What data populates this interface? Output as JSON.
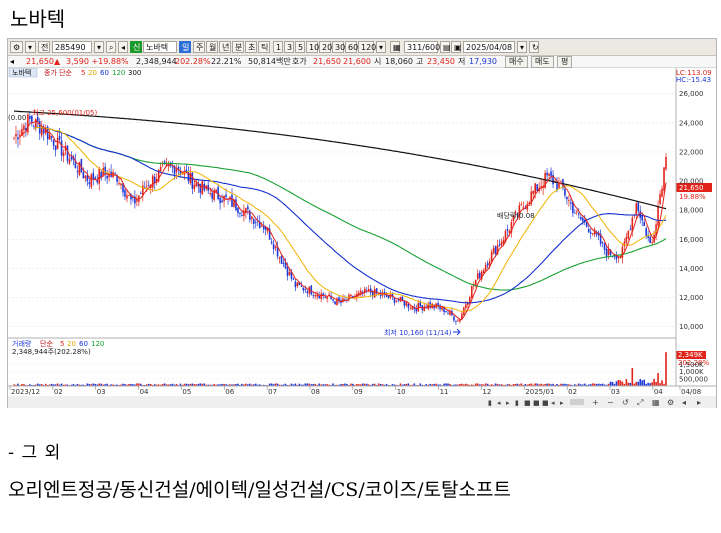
{
  "heading": "노바텍",
  "toolbar": {
    "code": "285490",
    "type_flag": "신",
    "name": "노바텍",
    "period_selected": "일",
    "periods": [
      "주",
      "월",
      "년",
      "분",
      "초",
      "틱"
    ],
    "intervals": [
      "1",
      "3",
      "5",
      "10",
      "20",
      "30",
      "60",
      "120"
    ],
    "count": "311/600",
    "date": "2025/04/08"
  },
  "infobar": {
    "price": "21,650▲",
    "change": "3,590 +19.88%",
    "volume": "2,348,944",
    "volume_ratio": "202.28%",
    "turnover": "22.21%",
    "amount": "50,814백만",
    "quote_label": "호가",
    "ask": "21,650",
    "bid": "21,600",
    "open_label": "시",
    "open": "18,060",
    "high_label": "고",
    "high": "23,450",
    "low_label": "저",
    "low": "17,930",
    "buy_btn": "매수",
    "sell_btn": "매도",
    "extra_btn": "평"
  },
  "chart": {
    "price_legend": {
      "name": "노바텍",
      "label": "종가 단순",
      "ma": [
        "5",
        "20",
        "60",
        "120",
        "300"
      ]
    },
    "volume_legend": {
      "label": "거래량",
      "ma_label": "단순",
      "ma": [
        "5",
        "20",
        "60",
        "120"
      ],
      "value": "2,348,944주(202.28%)"
    },
    "lc_hc": [
      "LC:113.09",
      "HC:-15.43"
    ],
    "current_price_label": "21,650",
    "current_price_pct": "19.88%",
    "volume_badge": [
      "2,349K",
      "202.28%"
    ],
    "annotations": {
      "high": "최고 25,600(01/05)",
      "low": "최저 10,160 (11/14)",
      "left_value": "(0.00",
      "mid": "배당락(0.08"
    },
    "y_ticks": [
      "26,000",
      "24,000",
      "22,000",
      "20,000",
      "18,000",
      "16,000",
      "14,000",
      "12,000",
      "10,000"
    ],
    "vol_ticks": [
      "1,500K",
      "1,000K",
      "500,000"
    ],
    "x_ticks": [
      "2023/12",
      "02",
      "03",
      "04",
      "05",
      "06",
      "07",
      "08",
      "09",
      "10",
      "11",
      "12",
      "2025/01",
      "02",
      "03",
      "04",
      "04/08"
    ]
  },
  "colors": {
    "up": "#e2231a",
    "down": "#1e39d8",
    "ma5": "#e2231a",
    "ma20": "#f0b400",
    "ma60": "#1230d0",
    "ma120": "#18a030",
    "ma300": "#111111"
  },
  "chart_data": {
    "type": "candlestick",
    "price_axis": [
      10000,
      26000
    ],
    "approx_closes": [
      23000,
      24200,
      23600,
      22400,
      21300,
      20100,
      20500,
      20300,
      18400,
      19800,
      20700,
      21000,
      20000,
      19300,
      18900,
      18300,
      17600,
      16800,
      14700,
      12800,
      12500,
      12100,
      11600,
      12100,
      12400,
      12100,
      11800,
      11300,
      11500,
      11200,
      10400,
      12900,
      14600,
      16100,
      17800,
      19200,
      20300,
      19500,
      17600,
      16600,
      15100,
      14900,
      18500,
      15400,
      21650
    ],
    "annotation_high": 25600,
    "annotation_low": 10160,
    "last_close": 21650,
    "last_volume": 2348944
  },
  "after_title": "- 그 외",
  "companies": "오리엔트정공/동신건설/에이텍/일성건설/CS/코이즈/토탈소프트"
}
